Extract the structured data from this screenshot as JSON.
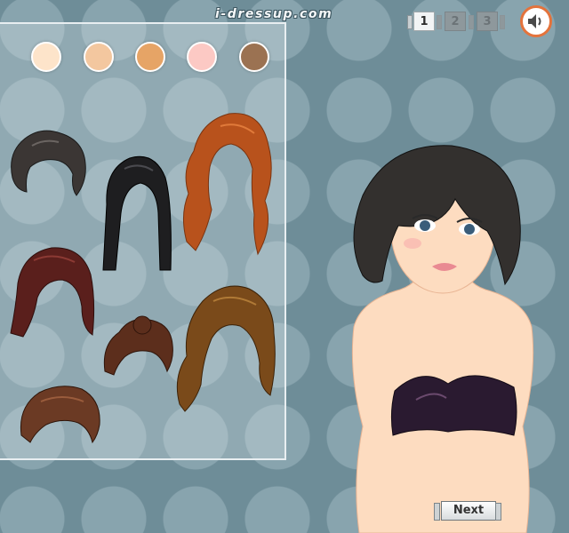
{
  "site": {
    "logo_text": "i-dressup.com"
  },
  "navigation": {
    "pages": [
      {
        "label": "1",
        "active": true
      },
      {
        "label": "2",
        "active": false
      },
      {
        "label": "3",
        "active": false
      }
    ],
    "sound_icon": "speaker-icon"
  },
  "skin_tones": [
    {
      "name": "fair",
      "color": "#fde4ca"
    },
    {
      "name": "light",
      "color": "#f3c79f"
    },
    {
      "name": "tan",
      "color": "#e6a466"
    },
    {
      "name": "pink",
      "color": "#fcc9c4"
    },
    {
      "name": "brown",
      "color": "#9b7252"
    }
  ],
  "hairstyles": [
    {
      "name": "short-curly-dark",
      "color": "#3b3634"
    },
    {
      "name": "long-straight-black",
      "color": "#1e1e20"
    },
    {
      "name": "long-wavy-red",
      "color": "#b8521c"
    },
    {
      "name": "shoulder-auburn",
      "color": "#5a1f1c"
    },
    {
      "name": "updo-brown",
      "color": "#5c2e1c"
    },
    {
      "name": "long-wavy-brown",
      "color": "#7a4a1a"
    },
    {
      "name": "pixie-brown",
      "color": "#6b3a24"
    }
  ],
  "model": {
    "current_hair_color": "#33302e",
    "skin_color": "#fddcc0",
    "top_color": "#2a1a30"
  },
  "footer": {
    "next_label": "Next"
  }
}
